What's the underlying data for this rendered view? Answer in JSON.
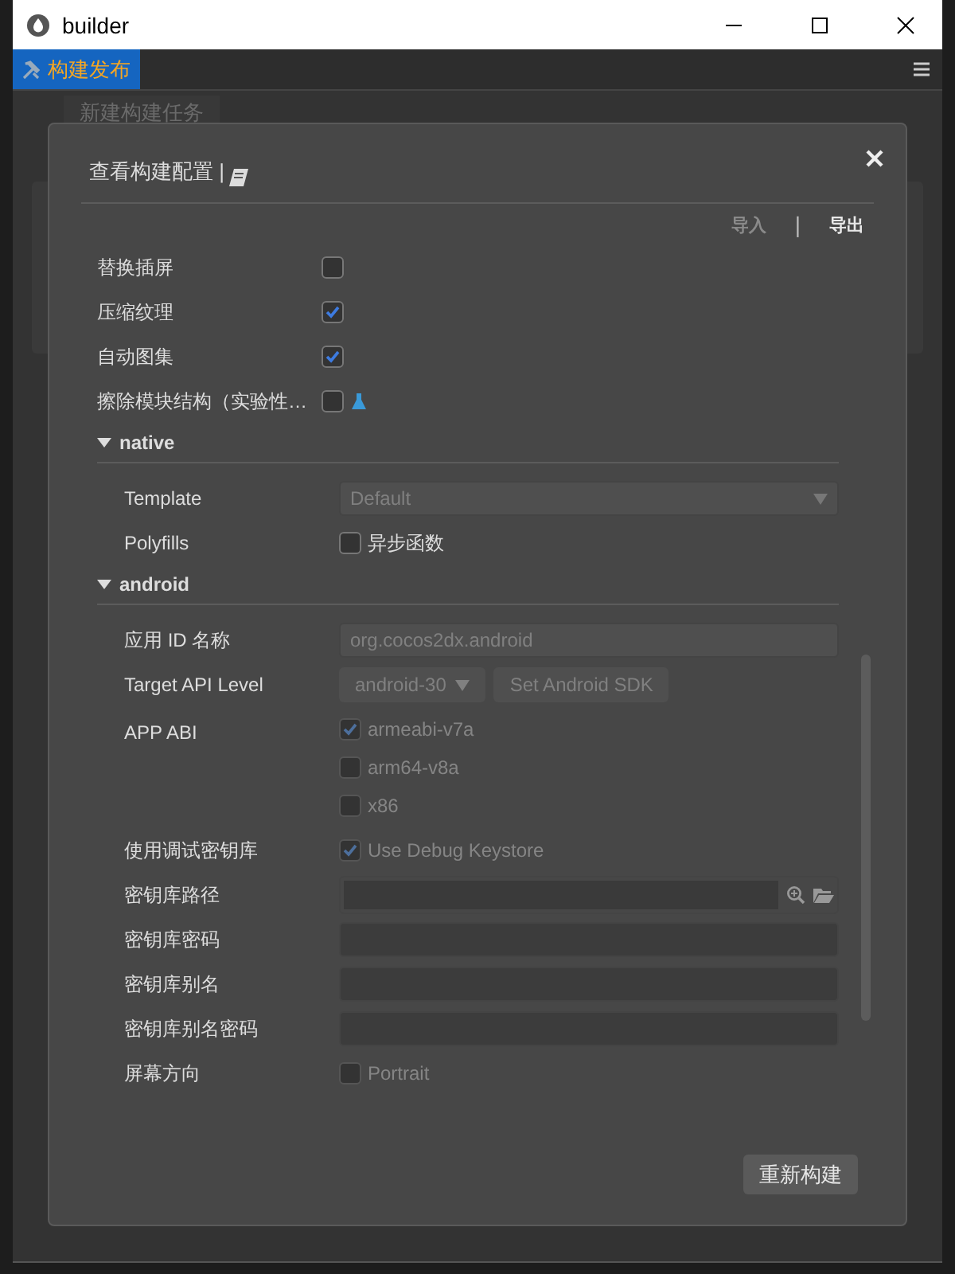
{
  "window": {
    "title": "builder"
  },
  "tabs": [
    {
      "label": "构建发布",
      "selected": true
    }
  ],
  "background_button": "新建构建任务",
  "dialog": {
    "title": "查看构建配置 |",
    "actions": [
      {
        "label": "导入",
        "disabled": true
      },
      {
        "label": "导出",
        "disabled": false
      }
    ],
    "action_separator": "|",
    "options": [
      {
        "label": "替换插屏",
        "checked": false,
        "experimental": false
      },
      {
        "label": "压缩纹理",
        "checked": true,
        "experimental": false
      },
      {
        "label": "自动图集",
        "checked": true,
        "experimental": false
      },
      {
        "label": "擦除模块结构（实验性…",
        "checked": false,
        "experimental": true
      }
    ],
    "sections": [
      {
        "title": "native",
        "expanded": true,
        "rows": [
          {
            "kind": "select",
            "label": "Template",
            "value": "Default",
            "disabled": true
          },
          {
            "kind": "checkboxes",
            "label": "Polyfills",
            "disabled": false,
            "options": [
              {
                "label": "异步函数",
                "checked": false
              }
            ]
          }
        ]
      },
      {
        "title": "android",
        "expanded": true,
        "rows": [
          {
            "kind": "text",
            "label": "应用 ID 名称",
            "value": "org.cocos2dx.android",
            "disabled": true
          },
          {
            "kind": "api",
            "label": "Target API Level",
            "value": "android-30",
            "button": "Set Android SDK",
            "disabled": true
          },
          {
            "kind": "checkboxes",
            "label": "APP ABI",
            "disabled": true,
            "options": [
              {
                "label": "armeabi-v7a",
                "checked": true
              },
              {
                "label": "arm64-v8a",
                "checked": false
              },
              {
                "label": "x86",
                "checked": false
              }
            ]
          },
          {
            "kind": "checkboxes",
            "label": "使用调试密钥库",
            "disabled": true,
            "options": [
              {
                "label": "Use Debug Keystore",
                "checked": true
              }
            ]
          },
          {
            "kind": "path",
            "label": "密钥库路径",
            "disabled": false
          },
          {
            "kind": "text",
            "label": "密钥库密码",
            "disabled": false
          },
          {
            "kind": "text",
            "label": "密钥库别名",
            "disabled": false
          },
          {
            "kind": "text",
            "label": "密钥库别名密码",
            "disabled": false
          },
          {
            "kind": "checkboxes",
            "label": "屏幕方向",
            "disabled": true,
            "options": [
              {
                "label": "Portrait",
                "checked": false
              }
            ]
          }
        ]
      }
    ],
    "footer_button": "重新构建"
  }
}
